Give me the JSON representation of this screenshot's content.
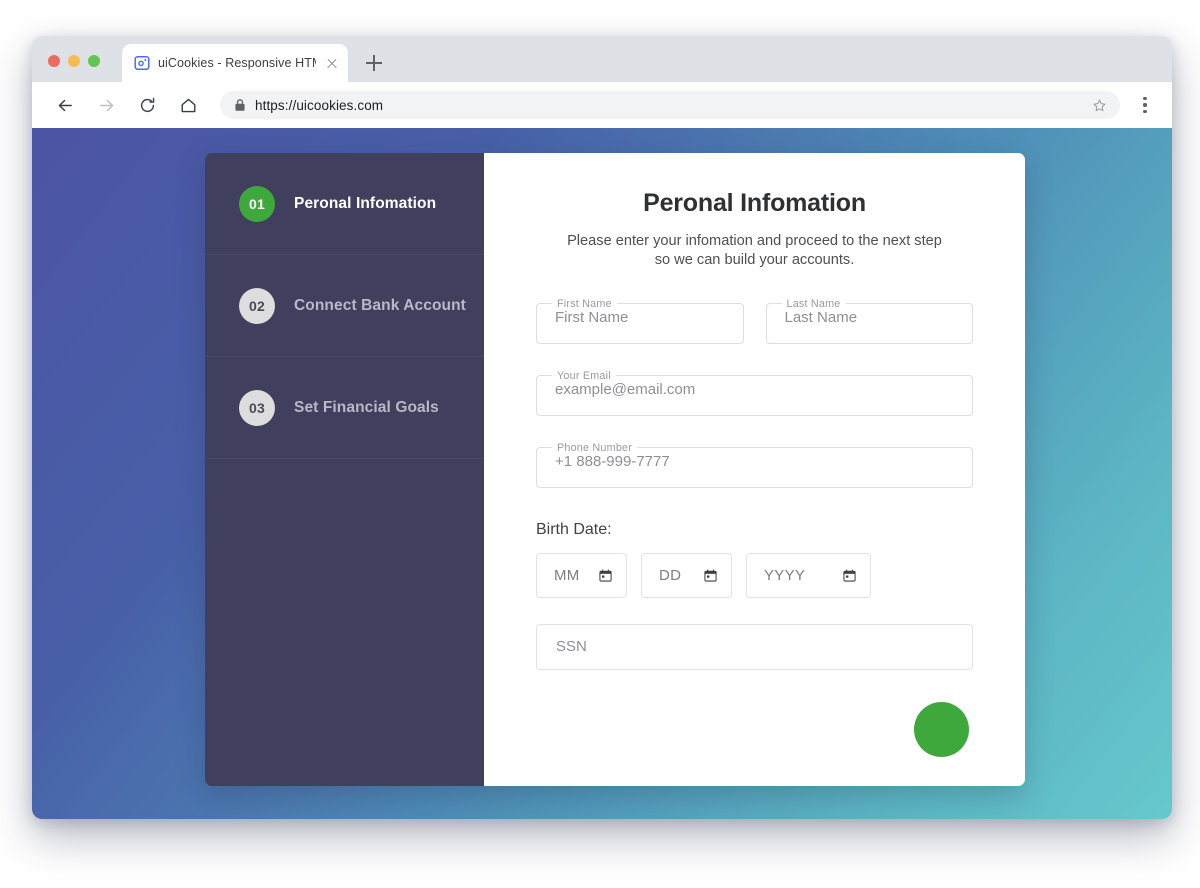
{
  "browser": {
    "traffic_lights": [
      "close",
      "minimize",
      "maximize"
    ],
    "tab": {
      "title": "uiCookies - Responsive HTML",
      "favicon": "app-window-icon",
      "close_icon": "close-icon"
    },
    "new_tab_icon": "plus-icon",
    "toolbar": {
      "back_icon": "arrow-left-icon",
      "forward_icon": "arrow-right-icon",
      "reload_icon": "reload-icon",
      "home_icon": "home-icon",
      "lock_icon": "lock-icon",
      "url": "https://uicookies.com",
      "bookmark_icon": "star-icon",
      "menu_icon": "three-dot-menu-icon"
    }
  },
  "page": {
    "background_gradient_from": "#4c54a4",
    "background_gradient_to": "#66c8cc"
  },
  "wizard": {
    "sidebar": {
      "background": "#413f5e",
      "active_color": "#3fa83c",
      "steps": [
        {
          "number": "01",
          "label": "Peronal Infomation",
          "active": true
        },
        {
          "number": "02",
          "label": "Connect Bank Account",
          "active": false
        },
        {
          "number": "03",
          "label": "Set Financial Goals",
          "active": false
        }
      ]
    },
    "form": {
      "title": "Peronal Infomation",
      "subtitle": "Please enter your infomation and proceed to the next step so we can build your accounts.",
      "fields": [
        {
          "label": "First Name",
          "placeholder": "First Name"
        },
        {
          "label": "Last Name",
          "placeholder": "Last Name"
        },
        {
          "label": "Your Email",
          "placeholder": "example@email.com"
        },
        {
          "label": "Phone Number",
          "placeholder": "+1 888-999-7777"
        }
      ],
      "birth_date": {
        "label": "Birth Date:",
        "inputs": [
          {
            "placeholder": "MM",
            "icon": "calendar-icon"
          },
          {
            "placeholder": "DD",
            "icon": "calendar-icon"
          },
          {
            "placeholder": "YYYY",
            "icon": "calendar-icon"
          }
        ]
      },
      "ssn": {
        "placeholder": "SSN"
      },
      "next_button": {
        "label": "",
        "color": "#3fa83c"
      }
    }
  }
}
